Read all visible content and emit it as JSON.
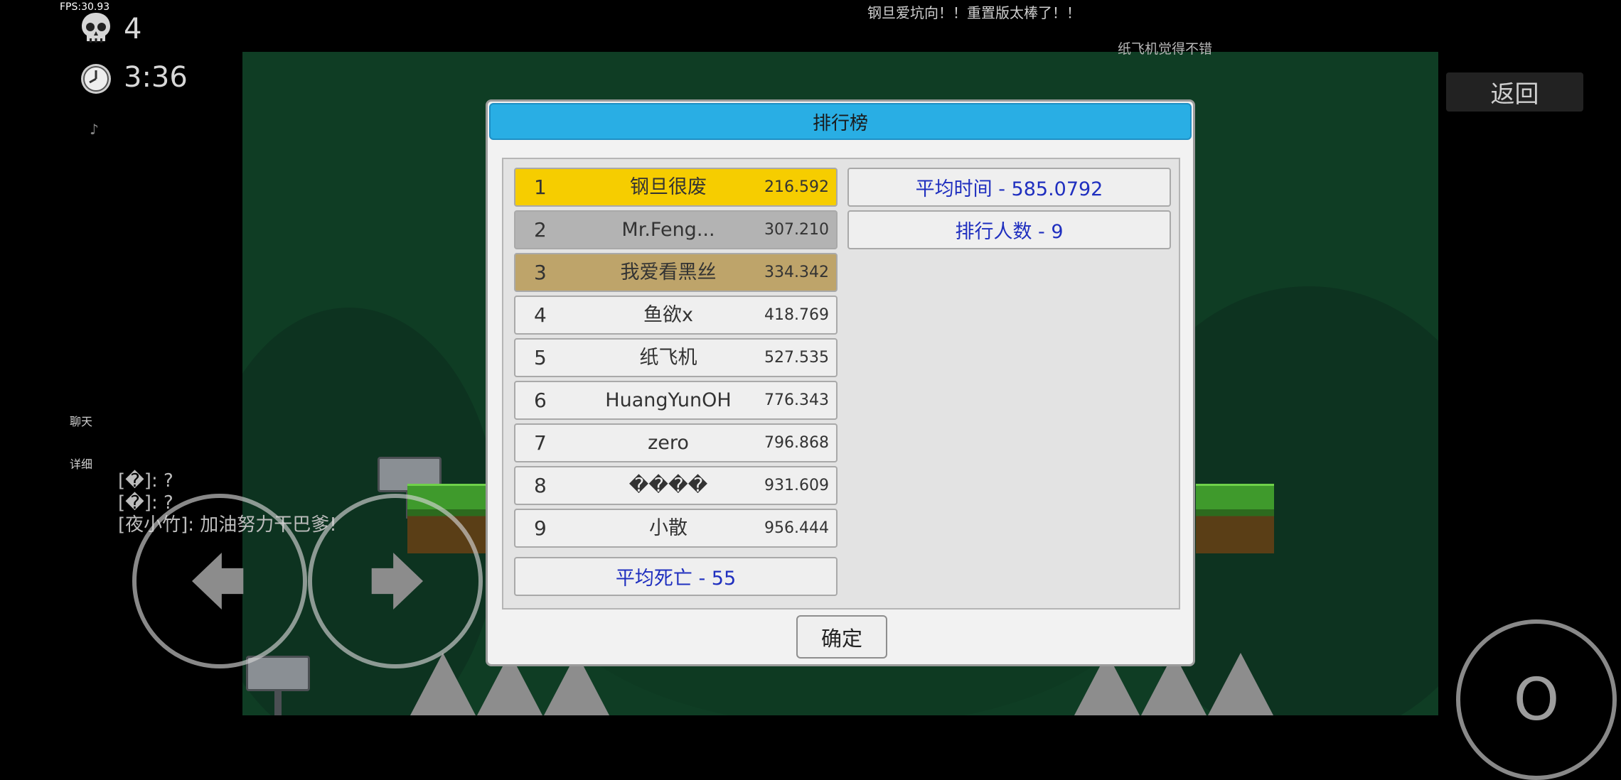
{
  "hud": {
    "fps": "FPS:30.93",
    "deaths": "4",
    "time": "3:36",
    "back_label": "返回",
    "chat_label": "聊天",
    "detail_label": "详细",
    "jump_label": "O"
  },
  "marquee": [
    "钢旦爱坑向！！重置版太棒了！！",
    "纸飞机觉得不错"
  ],
  "chat": [
    "[�]: ?",
    "[�]: ?",
    "[夜小竹]: 加油努力干巴爹!"
  ],
  "dialog": {
    "title": "排行榜",
    "rows": [
      {
        "rank": "1",
        "name": "钢旦很废",
        "score": "216.592",
        "color": "#f6cd00"
      },
      {
        "rank": "2",
        "name": "Mr.Feng...",
        "score": "307.210",
        "color": "#b3b3b3"
      },
      {
        "rank": "3",
        "name": "我爱看黑丝",
        "score": "334.342",
        "color": "#bea46a"
      },
      {
        "rank": "4",
        "name": "鱼欲x",
        "score": "418.769",
        "color": "#efefef"
      },
      {
        "rank": "5",
        "name": "纸飞机",
        "score": "527.535",
        "color": "#efefef"
      },
      {
        "rank": "6",
        "name": "HuangYunOH",
        "score": "776.343",
        "color": "#efefef"
      },
      {
        "rank": "7",
        "name": "zero",
        "score": "796.868",
        "color": "#efefef"
      },
      {
        "rank": "8",
        "name": "����",
        "score": "931.609",
        "color": "#efefef"
      },
      {
        "rank": "9",
        "name": "小散",
        "score": "956.444",
        "color": "#efefef"
      }
    ],
    "avg_death": "平均死亡 - 55",
    "avg_time": "平均时间 - 585.0792",
    "rank_count": "排行人数 - 9",
    "ok_label": "确定"
  },
  "colors": {
    "header": "#29aee4",
    "stat_text": "#1f2fbf"
  },
  "icons": [
    "skull-icon",
    "clock-icon",
    "music-note-icon",
    "arrow-left-icon",
    "arrow-right-icon"
  ]
}
